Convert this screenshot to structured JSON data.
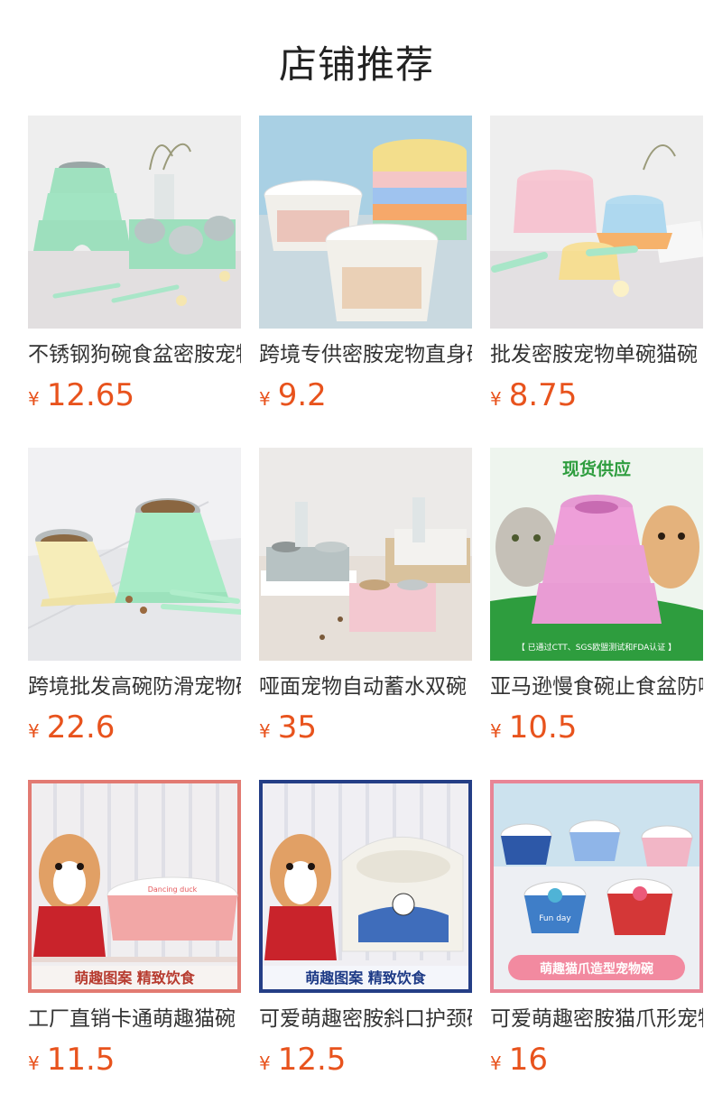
{
  "title": "店铺推荐",
  "currency": "¥",
  "price_color": "#e8531d",
  "products": [
    {
      "name": "不锈钢狗碗食盆密胺宠物碗",
      "price": "12.65"
    },
    {
      "name": "跨境专供密胺宠物直身碗",
      "price": "9.2"
    },
    {
      "name": "批发密胺宠物单碗猫碗",
      "price": "8.75"
    },
    {
      "name": "跨境批发高碗防滑宠物碗",
      "price": "22.6"
    },
    {
      "name": "哑面宠物自动蓄水双碗",
      "price": "35"
    },
    {
      "name": "亚马逊慢食碗止食盆防噎",
      "price": "10.5"
    },
    {
      "name": "工厂直销卡通萌趣猫碗",
      "price": "11.5"
    },
    {
      "name": "可爱萌趣密胺斜口护颈碗",
      "price": "12.5"
    },
    {
      "name": "可爱萌趣密胺猫爪形宠物碗",
      "price": "16"
    }
  ],
  "image_text": {
    "p6_banner_top": "现货供应",
    "p6_banner_bottom": "【 已通过CTT、SGS欧盟测试和FDA认证 】",
    "p7_banner": "萌趣图案 精致饮食",
    "p8_banner": "萌趣图案 精致饮食",
    "p9_banner": "萌趣猫爪造型宠物碗",
    "p7_bowl_text": "Dancing duck",
    "p9_bowl_text": "Fun day"
  }
}
